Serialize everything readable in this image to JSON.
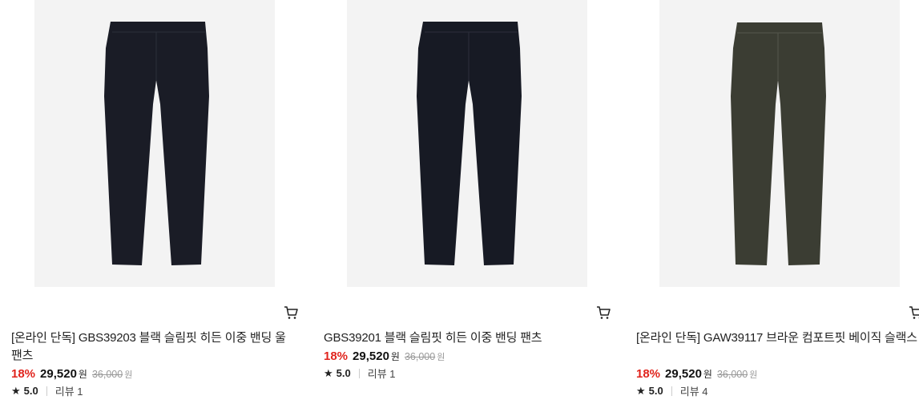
{
  "products": [
    {
      "title": "[온라인 단독] GBS39203 블랙 슬림핏 히든 이중 밴딩 울 팬츠",
      "discount": "18%",
      "price": "29,520",
      "currency": "원",
      "original_price": "36,000",
      "original_currency": "원",
      "rating": "5.0",
      "review_label": "리뷰 1",
      "pants_color": "#1a1c26",
      "cart_icon": "cart-icon"
    },
    {
      "title": "GBS39201 블랙 슬림핏 히든 이중 밴딩 팬츠",
      "discount": "18%",
      "price": "29,520",
      "currency": "원",
      "original_price": "36,000",
      "original_currency": "원",
      "rating": "5.0",
      "review_label": "리뷰 1",
      "pants_color": "#171a24",
      "cart_icon": "cart-icon"
    },
    {
      "title": "[온라인 단독] GAW39117 브라운 컴포트핏 베이직 슬랙스",
      "discount": "18%",
      "price": "29,520",
      "currency": "원",
      "original_price": "36,000",
      "original_currency": "원",
      "rating": "5.0",
      "review_label": "리뷰 4",
      "pants_color": "#3b3d33",
      "cart_icon": "cart-icon"
    }
  ],
  "colors": {
    "discount": "#e0241d",
    "thumb_bg": "#f3f3f3"
  }
}
